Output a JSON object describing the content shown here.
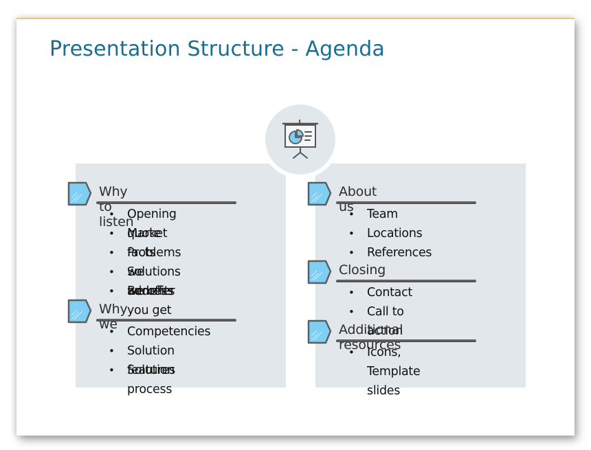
{
  "slide": {
    "title": "Presentation Structure - Agenda",
    "accent_color": "#1b6e92",
    "panel_color": "#e1e7eb",
    "tag_color": "#7fcff5",
    "center_icon": "presentation-board-pie-chart-icon"
  },
  "left_column": {
    "sections": [
      {
        "title": "Why to listen",
        "icon": "pencil-tag-icon",
        "items": [
          "Opening quote",
          "Market facts",
          "Problems we address",
          "Solutions we offer",
          "Benefits you get"
        ]
      },
      {
        "title": "Why we",
        "icon": "pencil-tag-icon",
        "items": [
          "Competencies",
          "Solution features",
          "Solution process"
        ]
      }
    ]
  },
  "right_column": {
    "sections": [
      {
        "title": "About us",
        "icon": "pencil-tag-icon",
        "items": [
          "Team",
          "Locations",
          "References"
        ]
      },
      {
        "title": "Closing",
        "icon": "pencil-tag-icon",
        "items": [
          "Contact",
          "Call to action"
        ]
      },
      {
        "title": "Additional resources",
        "icon": "pencil-tag-icon",
        "items": [
          "Icons, Template slides"
        ]
      }
    ]
  }
}
